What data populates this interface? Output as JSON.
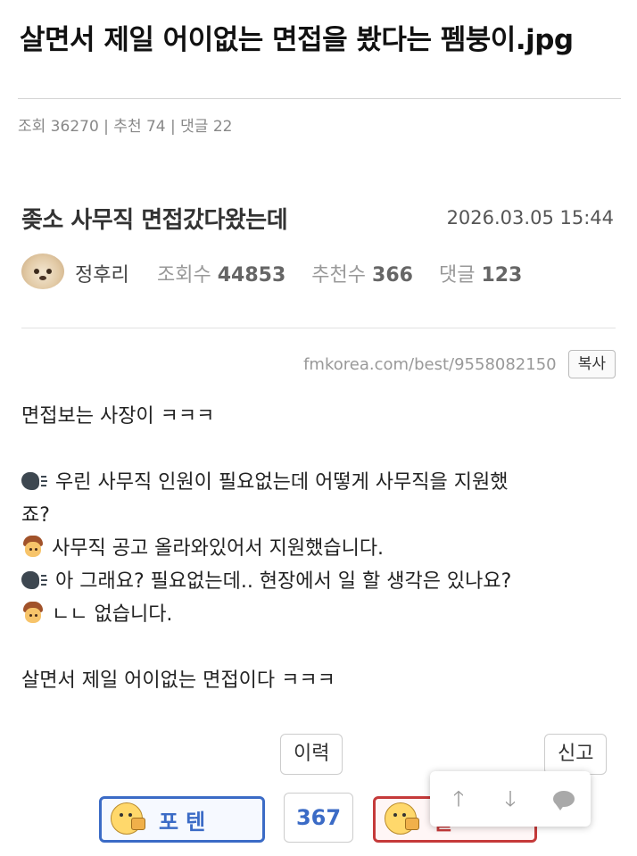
{
  "page": {
    "title": "살면서 제일 어이없는 면접을 봤다는 펨붕이.jpg",
    "meta": "조회 36270 | 추천 74 | 댓글 22"
  },
  "post": {
    "title": "좆소 사무직 면접갔다왔는데",
    "date": "2026.03.05 15:44",
    "author": "정후리",
    "stats": {
      "views_label": "조회수",
      "views": "44853",
      "recommend_label": "추천수",
      "recommend": "366",
      "comments_label": "댓글",
      "comments": "123"
    },
    "url": "fmkorea.com/best/9558082150",
    "copy_label": "복사",
    "lines": [
      "면접보는 사장이 ㅋㅋㅋ",
      "",
      "우린 사무직 인원이 필요없는데 어떻게 사무직을 지원했",
      "죠?",
      "사무직 공고 올라와있어서 지원했습니다.",
      "아 그래요? 필요없는데.. 현장에서 일 할 생각은 있나요?",
      "ㄴㄴ 없습니다.",
      "",
      "살면서 제일 어이없는 면접이다 ㅋㅋㅋ"
    ],
    "icons": {
      "speaking_head": "speaking-head-icon",
      "man": "man-icon"
    }
  },
  "actions": {
    "history_label": "이력",
    "report_label": "신고",
    "vote_up_label": "포텐",
    "vote_count": "367",
    "vote_down_label": "실"
  },
  "colors": {
    "vote_up": "#3b6bc6",
    "vote_down": "#c53a3a"
  }
}
